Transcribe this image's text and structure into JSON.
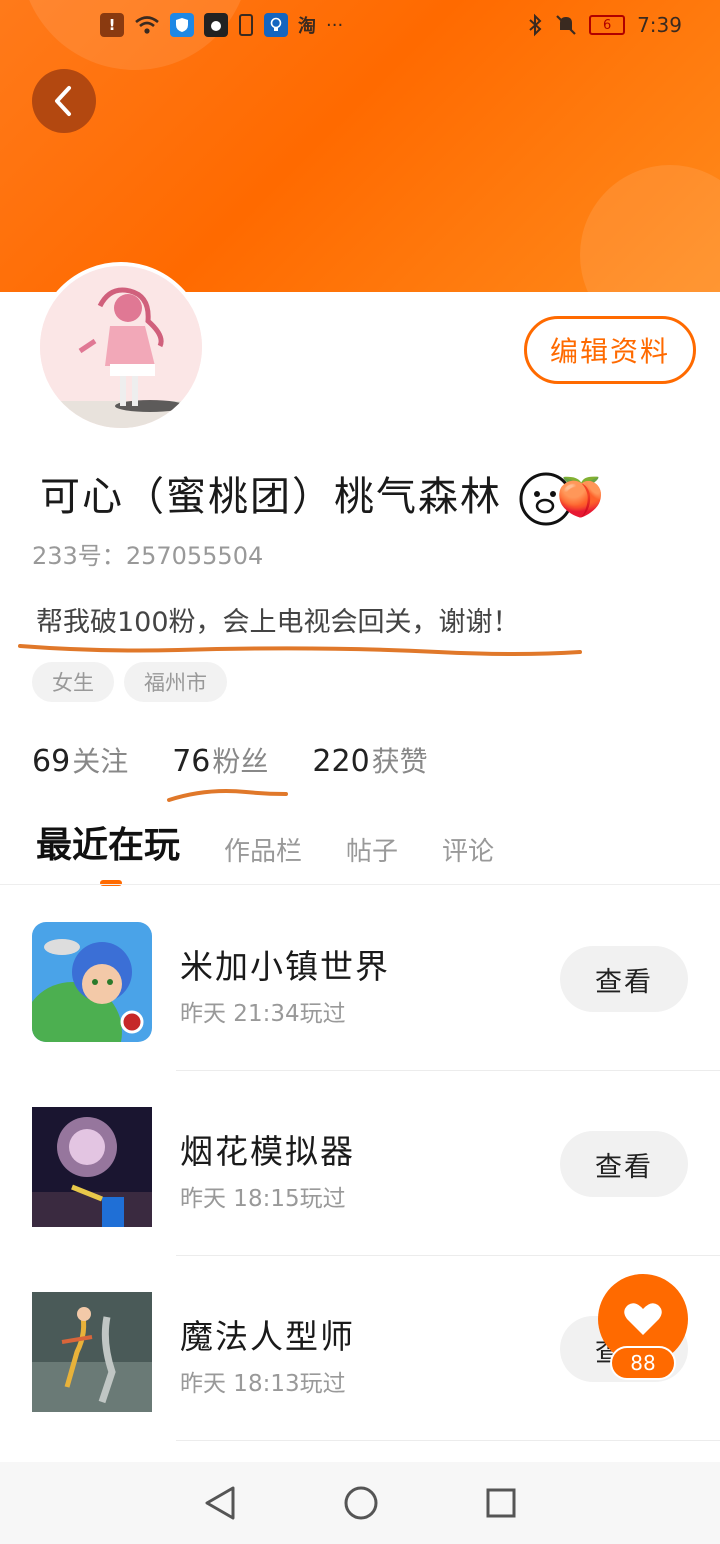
{
  "status_bar": {
    "time": "7:39",
    "battery": "6",
    "taobao": "淘",
    "more": "···"
  },
  "profile": {
    "nickname": "可心（蜜桃团）桃气森林",
    "nickname_emoji": "🍑",
    "uid_label": "233号：",
    "uid": "257055504",
    "bio": "帮我破100粉，会上电视会回关，谢谢！",
    "tags": [
      "女生",
      "福州市"
    ],
    "edit_label": "编辑资料"
  },
  "stats": [
    {
      "num": "69",
      "label": "关注"
    },
    {
      "num": "76",
      "label": "粉丝"
    },
    {
      "num": "220",
      "label": "获赞"
    }
  ],
  "tabs": [
    {
      "label": "最近在玩",
      "active": true
    },
    {
      "label": "作品栏",
      "active": false
    },
    {
      "label": "帖子",
      "active": false
    },
    {
      "label": "评论",
      "active": false
    }
  ],
  "games": [
    {
      "name": "米加小镇世界",
      "time": "昨天 21:34玩过",
      "button": "查看"
    },
    {
      "name": "烟花模拟器",
      "time": "昨天 18:15玩过",
      "button": "查看"
    },
    {
      "name": "魔法人型师",
      "time": "昨天 18:13玩过",
      "button": "查看"
    }
  ],
  "like": {
    "count": "88"
  },
  "colors": {
    "accent": "#ff6a00",
    "back_button": "#b34810"
  }
}
